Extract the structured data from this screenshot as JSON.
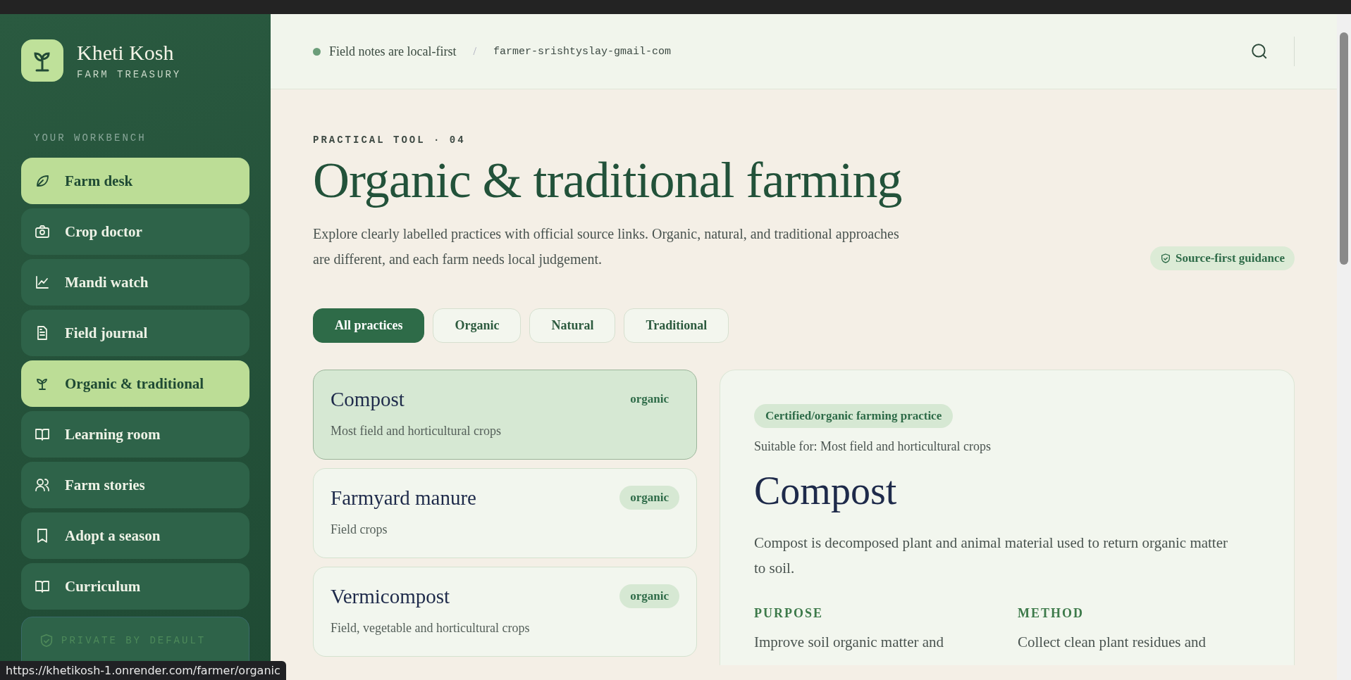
{
  "brand": {
    "name": "Kheti Kosh",
    "tagline": "FARM TREASURY"
  },
  "sidebar": {
    "heading": "YOUR WORKBENCH",
    "items": [
      {
        "label": "Farm desk",
        "kind": "leaf",
        "selected": true
      },
      {
        "label": "Crop doctor",
        "kind": "camera",
        "selected": false
      },
      {
        "label": "Mandi watch",
        "kind": "chart",
        "selected": false
      },
      {
        "label": "Field journal",
        "kind": "doc",
        "selected": false
      },
      {
        "label": "Organic & traditional",
        "kind": "sprout",
        "selected": true
      },
      {
        "label": "Learning room",
        "kind": "book",
        "selected": false
      },
      {
        "label": "Farm stories",
        "kind": "people",
        "selected": false
      },
      {
        "label": "Adopt a season",
        "kind": "bookmark",
        "selected": false
      },
      {
        "label": "Curriculum",
        "kind": "book",
        "selected": false
      }
    ],
    "privacy_card": {
      "title": "PRIVATE BY DEFAULT"
    }
  },
  "header": {
    "status": "Field notes are local-first",
    "separator": "/",
    "user": "farmer-srishtyslay-gmail-com"
  },
  "page": {
    "eyebrow": "PRACTICAL TOOL · 04",
    "title": "Organic & traditional farming",
    "intro": "Explore clearly labelled practices with official source links. Organic, natural, and traditional approaches are different, and each farm needs local judgement.",
    "badge": "Source-first guidance"
  },
  "filters": [
    {
      "label": "All practices",
      "selected": true
    },
    {
      "label": "Organic",
      "selected": false
    },
    {
      "label": "Natural",
      "selected": false
    },
    {
      "label": "Traditional",
      "selected": false
    }
  ],
  "practices": [
    {
      "name": "Compost",
      "tag": "organic",
      "crops": "Most field and horticultural crops",
      "selected": true
    },
    {
      "name": "Farmyard manure",
      "tag": "organic",
      "crops": "Field crops",
      "selected": false
    },
    {
      "name": "Vermicompost",
      "tag": "organic",
      "crops": "Field, vegetable and horticultural crops",
      "selected": false
    }
  ],
  "detail": {
    "category": "Certified/organic farming practice",
    "suitable": "Suitable for: Most field and horticultural crops",
    "title": "Compost",
    "summary": "Compost is decomposed plant and animal material used to return organic matter to soil.",
    "sections": [
      {
        "heading": "PURPOSE",
        "text": "Improve soil organic matter and"
      },
      {
        "heading": "METHOD",
        "text": "Collect clean plant residues and"
      }
    ]
  },
  "link_preview": "https://khetikosh-1.onrender.com/farmer/organic"
}
